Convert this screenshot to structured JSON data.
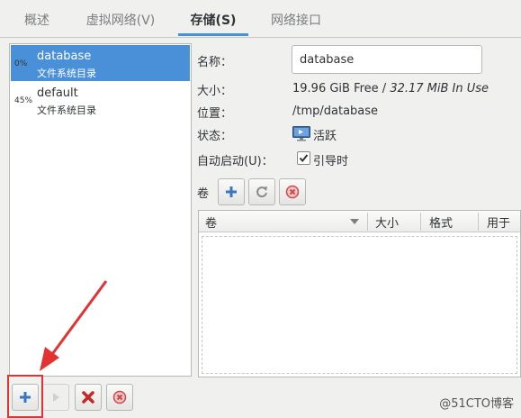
{
  "tabs": [
    {
      "label": "概述"
    },
    {
      "label": "虚拟网络(V)"
    },
    {
      "label": "存储(S)"
    },
    {
      "label": "网络接口"
    }
  ],
  "pools": [
    {
      "percent": "0%",
      "name": "database",
      "type": "文件系统目录"
    },
    {
      "percent": "45%",
      "name": "default",
      "type": "文件系统目录"
    }
  ],
  "details": {
    "name_label": "名称：",
    "name_value": "database",
    "size_label": "大小：",
    "size_free": "19.96 GiB Free",
    "size_sep": " / ",
    "size_in_use": "32.17 MiB In Use",
    "location_label": "位置：",
    "location_value": "/tmp/database",
    "state_label": "状态：",
    "state_value": "活跃",
    "autostart_label": "自动启动(U)：",
    "autostart_value": "引导时",
    "volumes_label": "卷"
  },
  "volume_table": {
    "columns": [
      "卷",
      "大小",
      "格式",
      "用于"
    ]
  },
  "watermark": "@51CTO博客",
  "colors": {
    "accent": "#4a90d9",
    "annotation": "#e23232"
  }
}
